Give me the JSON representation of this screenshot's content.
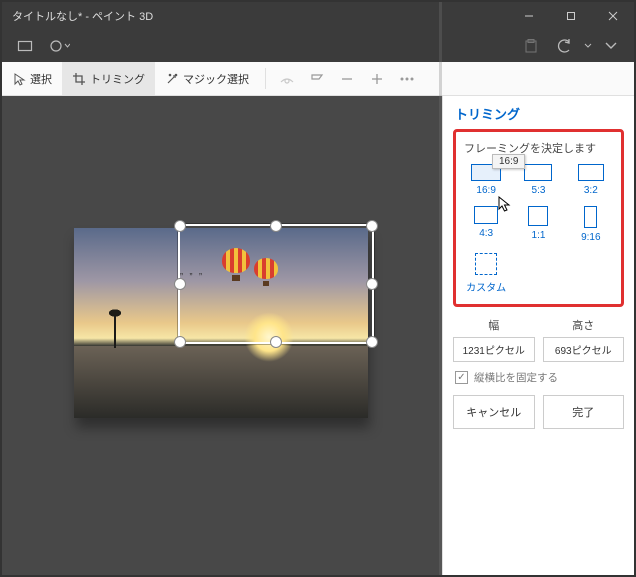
{
  "window": {
    "title": "タイトルなし* - ペイント 3D"
  },
  "toolbar": {
    "select": "選択",
    "crop": "トリミング",
    "magic": "マジック選択"
  },
  "panel": {
    "title": "トリミング",
    "frame_label": "フレーミングを決定します",
    "tooltip": "16:9",
    "aspects": {
      "a0": "16:9",
      "a1": "5:3",
      "a2": "3:2",
      "a3": "4:3",
      "a4": "1:1",
      "a5": "9:16",
      "custom": "カスタム"
    },
    "width_label": "幅",
    "height_label": "高さ",
    "width_value": "1231ピクセル",
    "height_value": "693ピクセル",
    "lock_label": "縦横比を固定する",
    "cancel": "キャンセル",
    "done": "完了"
  }
}
